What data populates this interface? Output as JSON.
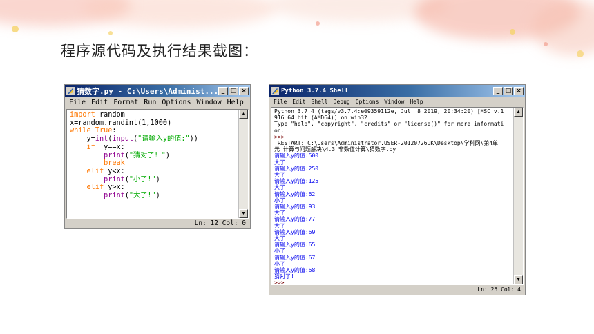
{
  "slide": {
    "title": "程序源代码及执行结果截图："
  },
  "editor": {
    "title": "猜数字.py - C:\\Users\\Administ...",
    "menu": [
      "File",
      "Edit",
      "Format",
      "Run",
      "Options",
      "Window",
      "Help"
    ],
    "code": {
      "l1_kw": "import",
      "l1_rest": " random",
      "l2": "x=random.randint(1,1000)",
      "l3_kw": "while",
      "l3_sp": " ",
      "l3_true": "True",
      "l3_colon": ":",
      "l4_pre": "    y=",
      "l4_int": "int",
      "l4_p": "(",
      "l4_input": "input",
      "l4_p2": "(",
      "l4_str": "\"请输入y的值:\"",
      "l4_end": "))",
      "l5_kw": "if",
      "l5_rest": "  y==x:",
      "l6_pre": "        ",
      "l6_fn": "print",
      "l6_p": "(",
      "l6_str": "\"猜对了！\"",
      "l6_end": ")",
      "l7_pre": "        ",
      "l7_kw": "break",
      "l8_kw": "elif",
      "l8_rest": " y<x:",
      "l9_pre": "        ",
      "l9_fn": "print",
      "l9_p": "(",
      "l9_str": "\"小了!\"",
      "l9_end": ")",
      "l10_kw": "elif",
      "l10_rest": " y>x:",
      "l11_pre": "        ",
      "l11_fn": "print",
      "l11_p": "(",
      "l11_str": "\"大了!\"",
      "l11_end": ")"
    },
    "status": "Ln: 12  Col: 0"
  },
  "shell": {
    "title": "Python 3.7.4 Shell",
    "menu": [
      "File",
      "Edit",
      "Shell",
      "Debug",
      "Options",
      "Window",
      "Help"
    ],
    "banner1": "Python 3.7.4 (tags/v3.7.4:e09359112e, Jul  8 2019, 20:34:20) [MSC v.1",
    "banner2": "916 64 bit (AMD64)] on win32",
    "banner3": "Type \"help\", \"copyright\", \"credits\" or \"license()\" for more informati",
    "banner4": "on.",
    "prompt": ">>>",
    "restart1": " RESTART: C:\\Users\\Administrator.USER-20120726UK\\Desktop\\学科网\\第4单",
    "restart2": "元 计算与问题解决\\4.3 非数值计算\\猜数字.py",
    "session": [
      {
        "ask": "请输入y的值:",
        "val": "500",
        "out": "大了!"
      },
      {
        "ask": "请输入y的值:",
        "val": "250",
        "out": "大了!"
      },
      {
        "ask": "请输入y的值:",
        "val": "125",
        "out": "大了!"
      },
      {
        "ask": "请输入y的值:",
        "val": "62",
        "out": "小了!"
      },
      {
        "ask": "请输入y的值:",
        "val": "93",
        "out": "大了!"
      },
      {
        "ask": "请输入y的值:",
        "val": "77",
        "out": "大了!"
      },
      {
        "ask": "请输入y的值:",
        "val": "69",
        "out": "大了!"
      },
      {
        "ask": "请输入y的值:",
        "val": "65",
        "out": "小了!"
      },
      {
        "ask": "请输入y的值:",
        "val": "67",
        "out": "小了!"
      },
      {
        "ask": "请输入y的值:",
        "val": "68",
        "out": "猜对了!"
      }
    ],
    "status": "Ln: 25  Col: 4"
  },
  "colors": {
    "keyword": "#ff7700",
    "builtin": "#900090",
    "string": "#00aa00",
    "shell_output": "#0000ee"
  }
}
